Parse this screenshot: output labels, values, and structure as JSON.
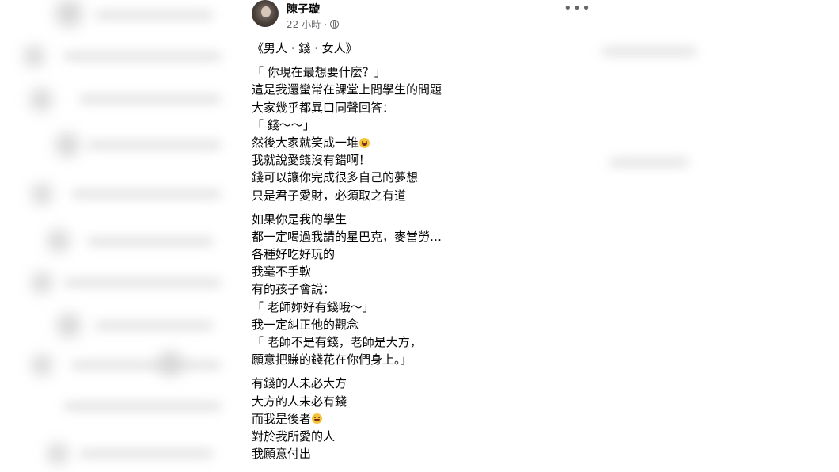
{
  "post": {
    "author": "陳子璇",
    "timestamp": "22 小時",
    "separator": "·",
    "privacy_icon": "globe-icon",
    "more_icon": "more-options-icon",
    "more_label": "•••",
    "lines": [
      "《男人 · 錢 · 女人》",
      "",
      "「 你現在最想要什麼？」",
      "這是我還蠻常在課堂上問學生的問題",
      "大家幾乎都異口同聲回答：",
      "「 錢～～」",
      "然後大家就笑成一堆",
      "我就說愛錢沒有錯啊！",
      "錢可以讓你完成很多自己的夢想",
      "只是君子愛財，必須取之有道",
      "",
      "如果你是我的學生",
      "都一定喝過我請的星巴克，麥當勞…",
      "各種好吃好玩的",
      "我毫不手軟",
      "有的孩子會說：",
      "「 老師妳好有錢哦～」",
      "我一定糾正他的觀念",
      "「 老師不是有錢，老師是大方，",
      "願意把賺的錢花在你們身上。」",
      "",
      "有錢的人未必大方",
      "大方的人未必有錢",
      "而我是後者",
      "對於我所愛的人",
      "我願意付出"
    ],
    "emoji_after_lines": [
      6,
      23
    ],
    "emoji_icon": "laughing-face-emoji-icon"
  }
}
